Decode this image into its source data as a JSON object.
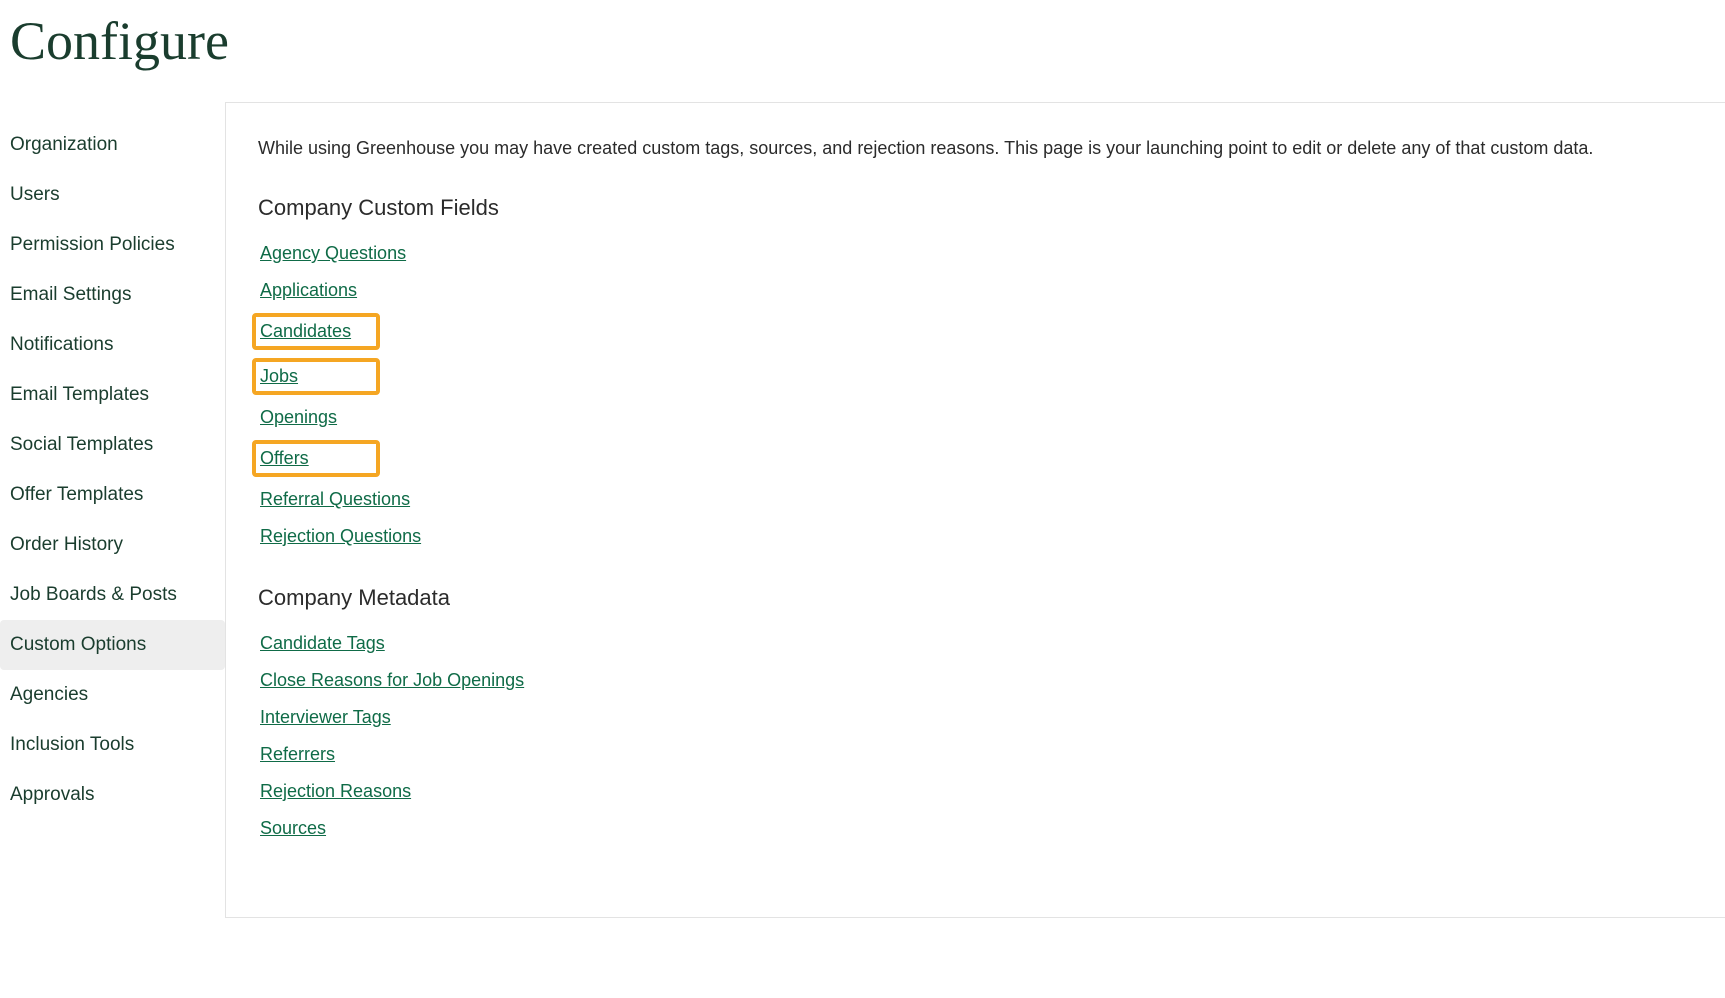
{
  "page": {
    "title": "Configure"
  },
  "sidebar": {
    "items": [
      {
        "label": "Organization",
        "active": false
      },
      {
        "label": "Users",
        "active": false
      },
      {
        "label": "Permission Policies",
        "active": false
      },
      {
        "label": "Email Settings",
        "active": false
      },
      {
        "label": "Notifications",
        "active": false
      },
      {
        "label": "Email Templates",
        "active": false
      },
      {
        "label": "Social Templates",
        "active": false
      },
      {
        "label": "Offer Templates",
        "active": false
      },
      {
        "label": "Order History",
        "active": false
      },
      {
        "label": "Job Boards & Posts",
        "active": false
      },
      {
        "label": "Custom Options",
        "active": true
      },
      {
        "label": "Agencies",
        "active": false
      },
      {
        "label": "Inclusion Tools",
        "active": false
      },
      {
        "label": "Approvals",
        "active": false
      }
    ]
  },
  "main": {
    "intro": "While using Greenhouse you may have created custom tags, sources, and rejection reasons. This page is your launching point to edit or delete any of that custom data.",
    "sections": {
      "custom_fields": {
        "heading": "Company Custom Fields",
        "links": [
          {
            "label": "Agency Questions",
            "highlighted": false
          },
          {
            "label": "Applications",
            "highlighted": false
          },
          {
            "label": "Candidates",
            "highlighted": true
          },
          {
            "label": "Jobs",
            "highlighted": true
          },
          {
            "label": "Openings",
            "highlighted": false
          },
          {
            "label": "Offers",
            "highlighted": true
          },
          {
            "label": "Referral Questions",
            "highlighted": false
          },
          {
            "label": "Rejection Questions",
            "highlighted": false
          }
        ]
      },
      "metadata": {
        "heading": "Company Metadata",
        "links": [
          {
            "label": "Candidate Tags"
          },
          {
            "label": "Close Reasons for Job Openings"
          },
          {
            "label": "Interviewer Tags"
          },
          {
            "label": "Referrers"
          },
          {
            "label": "Rejection Reasons"
          },
          {
            "label": "Sources"
          }
        ]
      }
    }
  }
}
